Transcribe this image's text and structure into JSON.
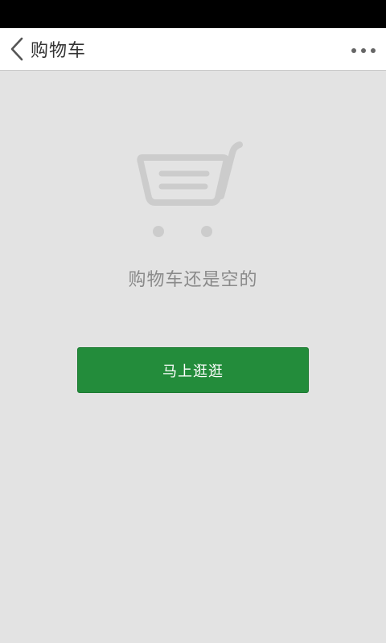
{
  "nav": {
    "title": "购物车",
    "back_icon": "chevron-left-icon",
    "more_icon": "more-horizontal-icon"
  },
  "empty_state": {
    "illustration_icon": "shopping-cart-icon",
    "message": "购物车还是空的",
    "button_label": "马上逛逛"
  },
  "colors": {
    "status_bar": "#000000",
    "nav_background": "#ffffff",
    "page_background": "#e3e3e3",
    "button": "#238c3b",
    "illustration": "#cccccc",
    "message_text": "#8a8a8a"
  }
}
